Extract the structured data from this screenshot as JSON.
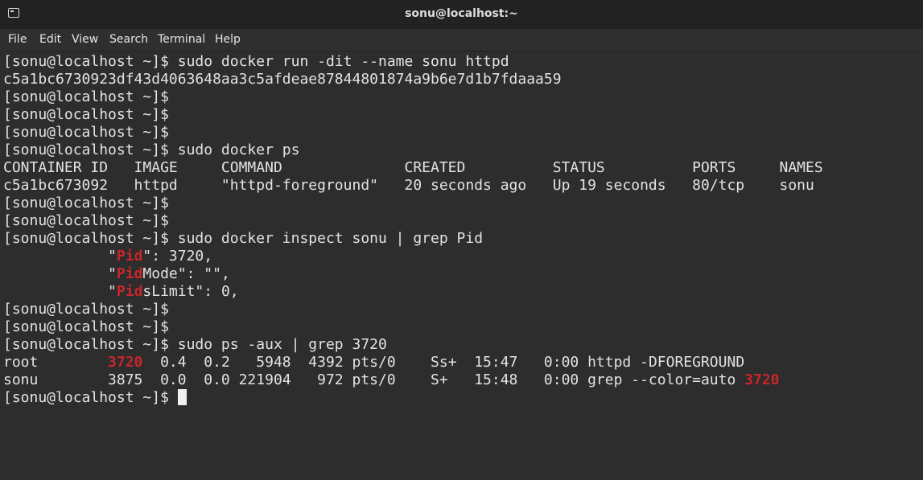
{
  "window": {
    "title": "sonu@localhost:~",
    "icon": "terminal-icon"
  },
  "menubar": {
    "items": [
      "File",
      "Edit",
      "View",
      "Search",
      "Terminal",
      "Help"
    ]
  },
  "colors": {
    "background": "#2d2d2d",
    "text": "#e3e3e3",
    "match_highlight": "#c8262a",
    "titlebar": "#222222"
  },
  "terminal": {
    "lines": [
      "[sonu@localhost ~]$ sudo docker run -dit --name sonu httpd",
      "c5a1bc6730923df43d4063648aa3c5afdeae87844801874a9b6e7d1b7fdaaa59",
      "[sonu@localhost ~]$",
      "[sonu@localhost ~]$",
      "[sonu@localhost ~]$",
      "[sonu@localhost ~]$ sudo docker ps",
      "CONTAINER ID   IMAGE     COMMAND              CREATED          STATUS          PORTS     NAMES",
      "c5a1bc673092   httpd     \"httpd-foreground\"   20 seconds ago   Up 19 seconds   80/tcp    sonu",
      "[sonu@localhost ~]$",
      "[sonu@localhost ~]$",
      "[sonu@localhost ~]$ sudo docker inspect sonu | grep Pid",
      "            \"Pid\": 3720,",
      "            \"PidMode\": \"\",",
      "            \"PidsLimit\": 0,",
      "[sonu@localhost ~]$",
      "[sonu@localhost ~]$",
      "[sonu@localhost ~]$ sudo ps -aux | grep 3720",
      "root        3720  0.4  0.2   5948  4392 pts/0    Ss+  15:47   0:00 httpd -DFOREGROUND",
      "sonu        3875  0.0  0.0 221904   972 pts/0    S+   15:48   0:00 grep --color=auto 3720",
      "[sonu@localhost ~]$ "
    ],
    "highlights": [
      {
        "line": 11,
        "text": "Pid"
      },
      {
        "line": 12,
        "text": "Pid"
      },
      {
        "line": 13,
        "text": "Pid"
      },
      {
        "line": 17,
        "text": "3720"
      },
      {
        "line": 18,
        "text": "3720",
        "last": true
      }
    ],
    "cursor_line": 19
  }
}
